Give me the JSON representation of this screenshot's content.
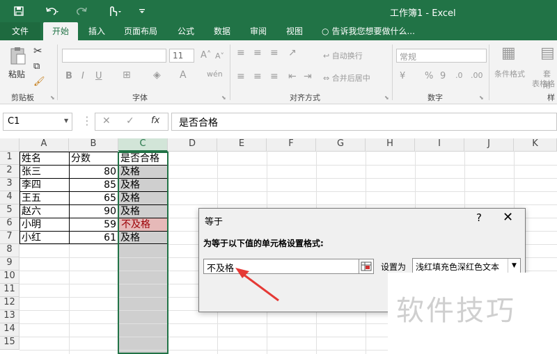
{
  "titlebar": {
    "title": "工作簿1 - Excel",
    "save_icon": "save-icon",
    "undo_icon": "undo-icon",
    "redo_icon": "redo-icon",
    "touch_icon": "touch-mode-icon",
    "customize_icon": "customize-qat-icon"
  },
  "tabs": [
    "文件",
    "开始",
    "插入",
    "页面布局",
    "公式",
    "数据",
    "审阅",
    "视图"
  ],
  "tell_me": "告诉我您想要做什么...",
  "ribbon": {
    "clipboard": {
      "label": "剪贴板",
      "paste": "粘贴"
    },
    "font": {
      "label": "字体",
      "size": "11",
      "bold": "B",
      "italic": "I",
      "underline": "U"
    },
    "alignment": {
      "label": "对齐方式",
      "wrap": "自动换行",
      "merge": "合并后居中"
    },
    "number": {
      "label": "数字",
      "format": "常规",
      "percent": "%",
      "comma": "9"
    },
    "styles": {
      "conditional": "条件格式",
      "table": "套用",
      "table2": "表格格",
      "label": "样"
    }
  },
  "formula_bar": {
    "name_box": "C1",
    "cancel": "✕",
    "enter": "✓",
    "fx": "fx",
    "content": "是否合格"
  },
  "sheet": {
    "columns": [
      "A",
      "B",
      "C",
      "D",
      "E",
      "F",
      "G",
      "H",
      "I",
      "J",
      "K"
    ],
    "rows": [
      "1",
      "2",
      "3",
      "4",
      "5",
      "6",
      "7",
      "8",
      "9",
      "10",
      "11",
      "12",
      "13",
      "14",
      "15"
    ],
    "headers": {
      "a": "姓名",
      "b": "分数",
      "c": "是否合格"
    },
    "data": [
      {
        "name": "张三",
        "score": "80",
        "pass": "及格"
      },
      {
        "name": "李四",
        "score": "85",
        "pass": "及格"
      },
      {
        "name": "王五",
        "score": "65",
        "pass": "及格"
      },
      {
        "name": "赵六",
        "score": "90",
        "pass": "及格"
      },
      {
        "name": "小明",
        "score": "59",
        "pass": "不及格"
      },
      {
        "name": "小红",
        "score": "61",
        "pass": "及格"
      }
    ],
    "highlight_color": "#e6b9b8",
    "highlight_text_color": "#9c0006"
  },
  "dialog": {
    "title": "等于",
    "help": "?",
    "close": "✕",
    "label": "为等于以下值的单元格设置格式:",
    "value": "不及格",
    "set_to": "设置为",
    "format_option": "浅红填充色深红色文本"
  },
  "watermark": "软件技巧"
}
